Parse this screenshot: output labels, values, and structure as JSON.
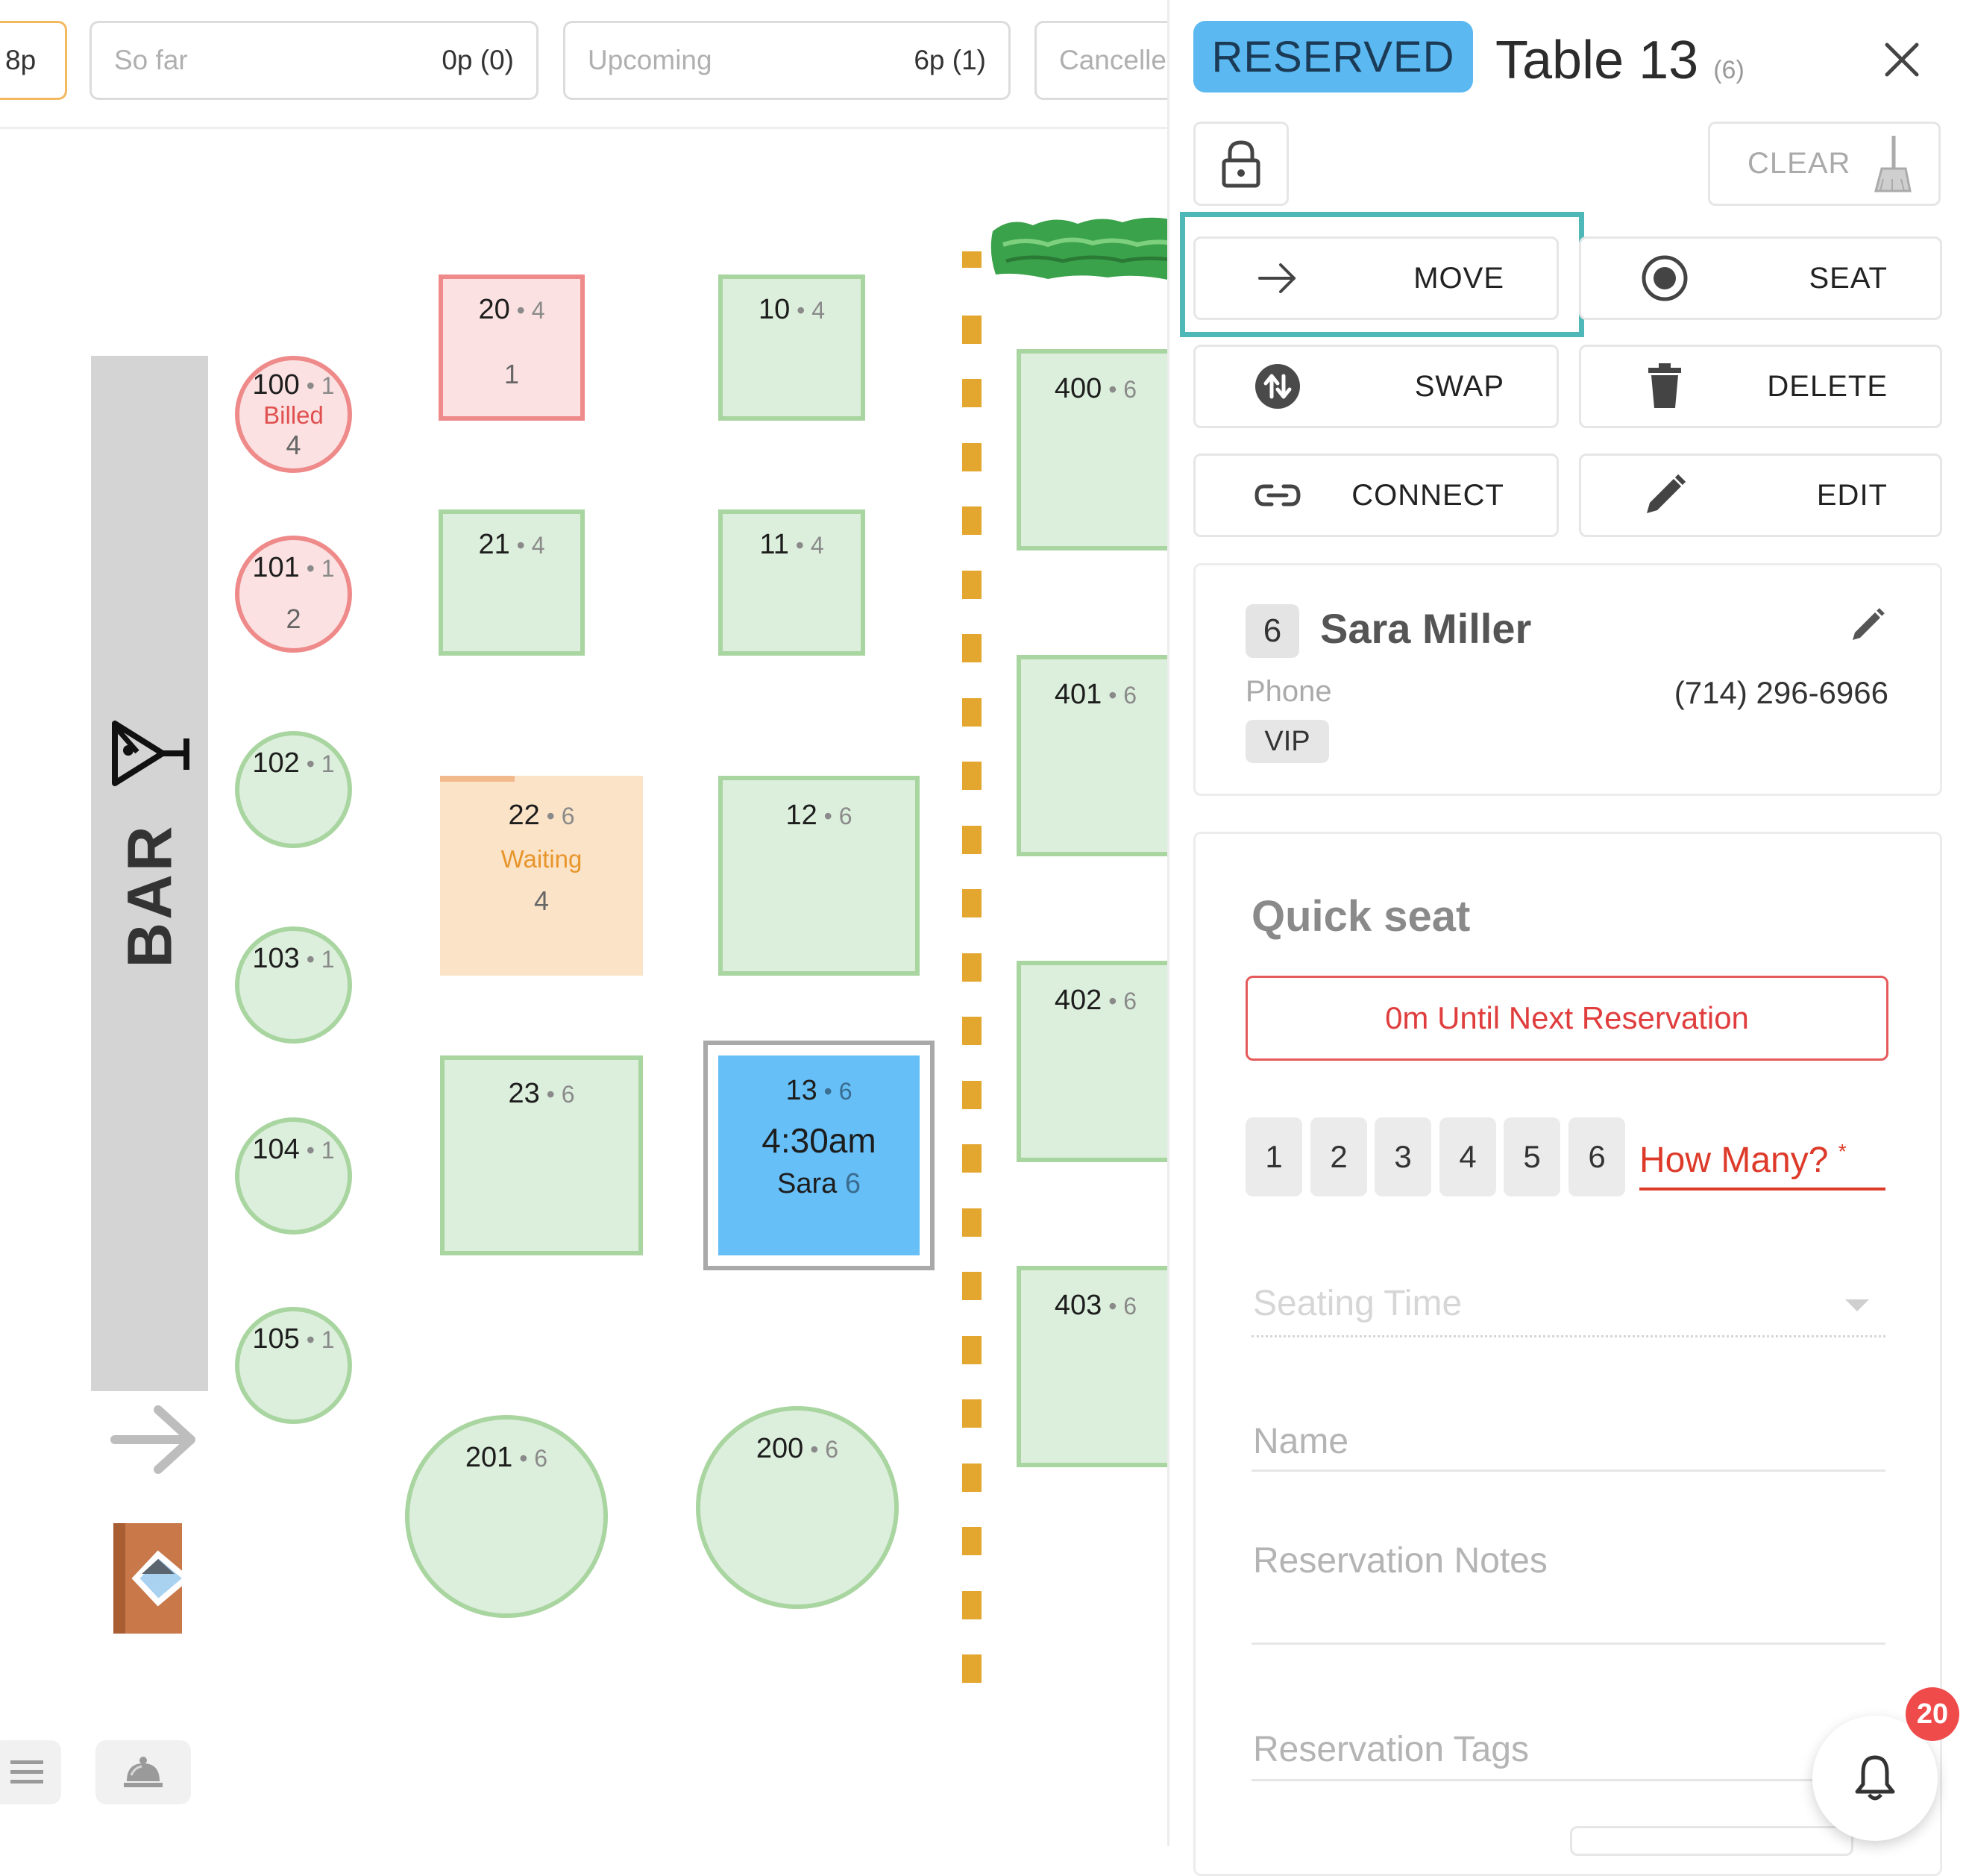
{
  "filters": [
    {
      "label": "8p",
      "count": ""
    },
    {
      "label": "So far",
      "count": "0p (0)"
    },
    {
      "label": "Upcoming",
      "count": "6p (1)"
    },
    {
      "label": "Cancelle",
      "count": ""
    }
  ],
  "bar_label": "BAR",
  "tables": {
    "t100": {
      "num": "100",
      "cap": "1",
      "status": "Billed",
      "party": "4"
    },
    "t101": {
      "num": "101",
      "cap": "1",
      "party": "2"
    },
    "t102": {
      "num": "102",
      "cap": "1"
    },
    "t103": {
      "num": "103",
      "cap": "1"
    },
    "t104": {
      "num": "104",
      "cap": "1"
    },
    "t105": {
      "num": "105",
      "cap": "1"
    },
    "t20": {
      "num": "20",
      "cap": "4",
      "party": "1"
    },
    "t21": {
      "num": "21",
      "cap": "4"
    },
    "t22": {
      "num": "22",
      "cap": "6",
      "status": "Waiting",
      "party": "4"
    },
    "t23": {
      "num": "23",
      "cap": "6"
    },
    "t10": {
      "num": "10",
      "cap": "4"
    },
    "t11": {
      "num": "11",
      "cap": "4"
    },
    "t12": {
      "num": "12",
      "cap": "6"
    },
    "t13": {
      "num": "13",
      "cap": "6",
      "time": "4:30am",
      "guest": "Sara",
      "party": "6"
    },
    "t201": {
      "num": "201",
      "cap": "6"
    },
    "t200": {
      "num": "200",
      "cap": "6"
    },
    "t400": {
      "num": "400",
      "cap": "6"
    },
    "t401": {
      "num": "401",
      "cap": "6"
    },
    "t402": {
      "num": "402",
      "cap": "6"
    },
    "t403": {
      "num": "403",
      "cap": "6"
    }
  },
  "panel": {
    "status_badge": "RESERVED",
    "title": "Table 13",
    "title_cap": "(6)",
    "clear_label": "CLEAR",
    "actions": {
      "move": "MOVE",
      "seat": "SEAT",
      "swap": "SWAP",
      "delete": "DELETE",
      "connect": "CONNECT",
      "edit": "EDIT"
    },
    "guest": {
      "party_size": "6",
      "name": "Sara Miller",
      "phone_label": "Phone",
      "phone": "(714) 296-6966",
      "tag": "VIP"
    },
    "quick_seat": {
      "title": "Quick seat",
      "until_button": "0m Until Next Reservation",
      "party_options": [
        "1",
        "2",
        "3",
        "4",
        "5",
        "6"
      ],
      "how_many_label": "How Many?",
      "required_mark": "*",
      "seating_time_placeholder": "Seating Time",
      "name_label": "Name",
      "notes_label": "Reservation Notes",
      "tags_label": "Reservation Tags"
    },
    "notifications_count": "20"
  },
  "colors": {
    "table_available": "#dcefdc",
    "table_billed": "#fbe1e1",
    "table_waiting": "#fbe3c8",
    "table_reserved": "#66bff7",
    "highlight": "#4eb8b8",
    "danger": "#e03e3e"
  }
}
